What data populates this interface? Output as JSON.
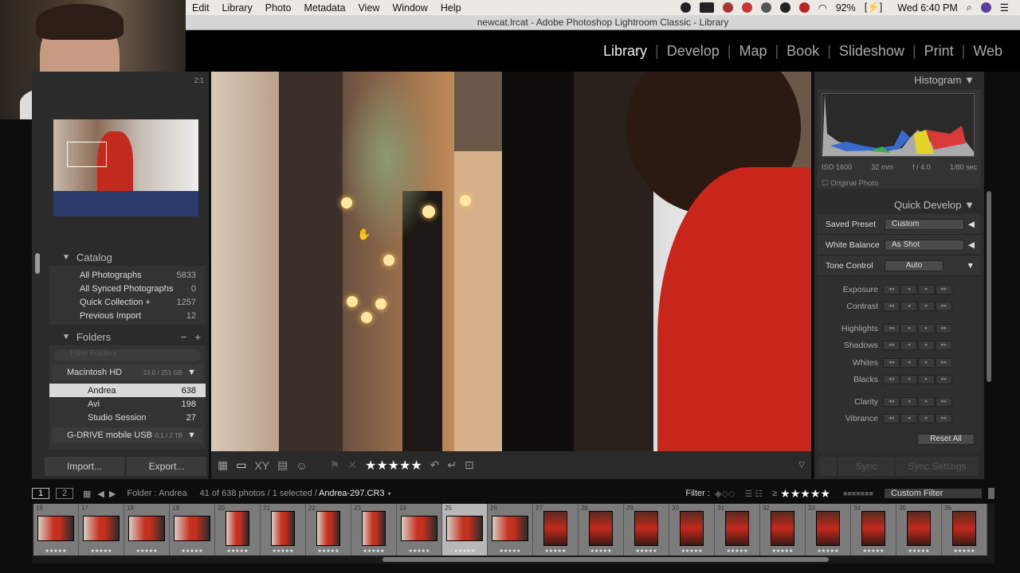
{
  "menubar": {
    "items": [
      "Edit",
      "Library",
      "Photo",
      "Metadata",
      "View",
      "Window",
      "Help"
    ],
    "battery": "92%",
    "clock": "Wed 6:40 PM"
  },
  "titlebar": {
    "title": "newcat.lrcat - Adobe Photoshop Lightroom Classic - Library"
  },
  "modules": [
    "Library",
    "Develop",
    "Map",
    "Book",
    "Slideshow",
    "Print",
    "Web"
  ],
  "navigator": {
    "zoom": "2:1"
  },
  "catalog": {
    "title": "Catalog",
    "items": [
      {
        "label": "All Photographs",
        "count": "5833"
      },
      {
        "label": "All Synced Photographs",
        "count": "0"
      },
      {
        "label": "Quick Collection +",
        "count": "1257"
      },
      {
        "label": "Previous Import",
        "count": "12"
      }
    ]
  },
  "folders": {
    "title": "Folders",
    "minus": "−",
    "plus": "+",
    "filter_placeholder": "Filter Folders",
    "volumes": [
      {
        "name": "Macintosh HD",
        "size": "13.0 / 251 GB"
      },
      {
        "name": "G-DRIVE mobile USB",
        "size": "0.1 / 2 TB"
      }
    ],
    "items": [
      {
        "label": "Andrea",
        "count": "638"
      },
      {
        "label": "Avi",
        "count": "198"
      },
      {
        "label": "Studio Session",
        "count": "27"
      }
    ]
  },
  "buttons": {
    "import": "Import...",
    "export": "Export...",
    "sync": "Sync",
    "sync_settings": "Sync Settings",
    "reset_all": "Reset All",
    "auto": "Auto"
  },
  "toolbar": {
    "rating": "★★★★★"
  },
  "histogram": {
    "title": "Histogram",
    "iso": "ISO 1600",
    "focal": "32 mm",
    "aperture": "f / 4.0",
    "shutter": "1/80 sec",
    "original": "Original Photo"
  },
  "quick_develop": {
    "title": "Quick Develop",
    "saved_preset_label": "Saved Preset",
    "saved_preset": "Custom",
    "wb_label": "White Balance",
    "wb": "As Shot",
    "tone_label": "Tone Control",
    "adjustments": [
      "Exposure",
      "Contrast",
      "Highlights",
      "Shadows",
      "Whites",
      "Blacks",
      "Clarity",
      "Vibrance"
    ]
  },
  "filmstrip_bar": {
    "page1": "1",
    "page2": "2",
    "source": "Folder : Andrea",
    "count": "41 of 638 photos / 1 selected /",
    "filename": "Andrea-297.CR3",
    "filter_label": "Filter :",
    "rating_op": "≥",
    "rating": "★★★★★",
    "custom_filter": "Custom Filter"
  },
  "filmstrip": [
    "16",
    "17",
    "18",
    "19",
    "20",
    "21",
    "22",
    "23",
    "24",
    "25",
    "26",
    "27",
    "28",
    "29",
    "30",
    "31",
    "32",
    "33",
    "34",
    "35",
    "36"
  ]
}
